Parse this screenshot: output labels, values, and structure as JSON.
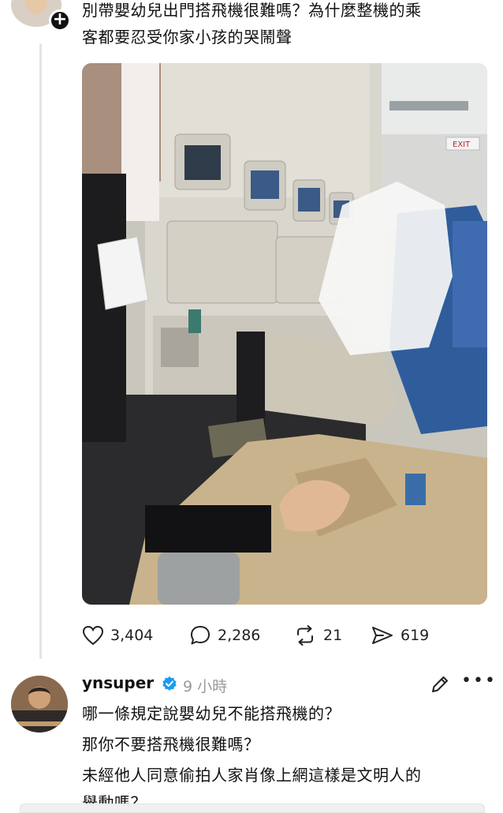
{
  "post": {
    "text_line1": "別帶嬰幼兒出門搭飛機很難嗎？為什麼整機的乘",
    "text_line2": "客都要忍受你家小孩的哭鬧聲",
    "photo": {
      "exit_sign": "EXIT"
    },
    "actions": {
      "likes": "3,404",
      "comments": "2,286",
      "reposts": "21",
      "shares": "619"
    }
  },
  "reply": {
    "username": "ynsuper",
    "time": "9 小時",
    "lines": [
      "哪一條規定說嬰幼兒不能搭飛機的？",
      "那你不要搭飛機很難嗎？",
      "未經他人同意偷拍人家肖像上網這樣是文明人的",
      "舉動嗎？"
    ]
  },
  "colors": {
    "verified": "#1d9bf0",
    "text": "#111111",
    "muted": "#9a9a9a"
  },
  "icons": {
    "like": "heart-icon",
    "comment": "speech-bubble-icon",
    "repost": "repost-icon",
    "share": "send-icon",
    "edit": "pencil-icon",
    "more": "more-dots-icon",
    "verified": "verified-badge-icon",
    "follow": "plus-icon"
  }
}
